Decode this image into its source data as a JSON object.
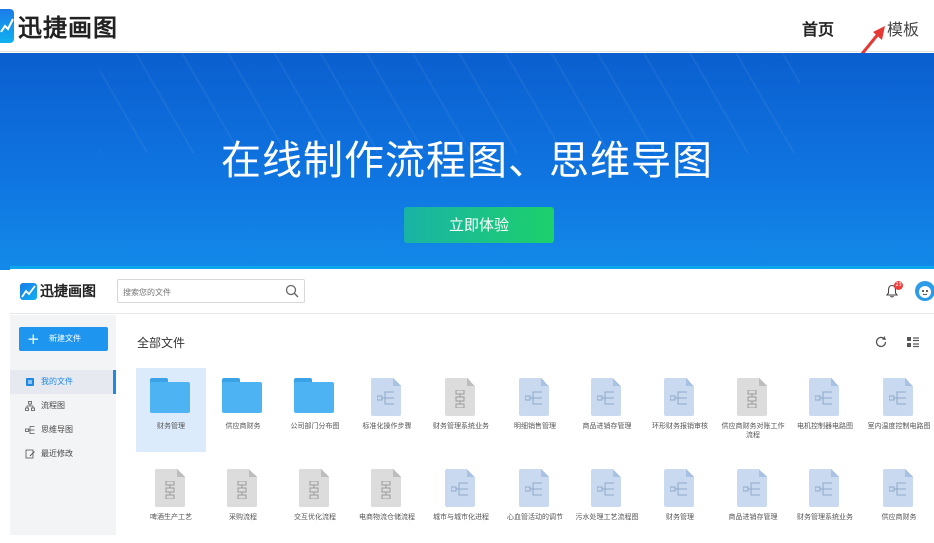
{
  "site": {
    "logo_text": "迅捷画图",
    "nav": {
      "home": "首页",
      "templates": "模板"
    }
  },
  "hero": {
    "title": "在线制作流程图、思维导图",
    "cta": "立即体验"
  },
  "app": {
    "logo_text": "迅捷画图",
    "search_placeholder": "搜索您的文件",
    "notification_count": "23",
    "sidebar": {
      "new_file": "新建文件",
      "items": [
        {
          "label": "我的文件",
          "icon": "folder-icon",
          "active": true
        },
        {
          "label": "流程图",
          "icon": "flowchart-icon"
        },
        {
          "label": "思维导图",
          "icon": "mindmap-icon"
        },
        {
          "label": "最近修改",
          "icon": "recent-icon"
        }
      ]
    },
    "main": {
      "title": "全部文件",
      "row1": [
        {
          "name": "财务管理",
          "type": "folder",
          "selected": true
        },
        {
          "name": "供应商财务",
          "type": "folder"
        },
        {
          "name": "公司部门分布图",
          "type": "folder"
        },
        {
          "name": "标准化操作步骤",
          "type": "mindmap"
        },
        {
          "name": "财务管理系统业务",
          "type": "flow"
        },
        {
          "name": "明细销售管理",
          "type": "mindmap"
        },
        {
          "name": "商品进销存管理",
          "type": "mindmap"
        },
        {
          "name": "环形财务报销审核",
          "type": "mindmap"
        },
        {
          "name": "供应商财务对账工作流程",
          "type": "flow"
        },
        {
          "name": "电机控制器电路图",
          "type": "mindmap"
        },
        {
          "name": "室内温度控制电路图",
          "type": "mindmap"
        }
      ],
      "row2": [
        {
          "name": "啤酒生产工艺",
          "type": "flow"
        },
        {
          "name": "采购流程",
          "type": "flow"
        },
        {
          "name": "交互优化流程",
          "type": "flow"
        },
        {
          "name": "电商物流仓储流程",
          "type": "flow"
        },
        {
          "name": "城市与城市化进程",
          "type": "mindmap"
        },
        {
          "name": "心血管活动的调节",
          "type": "mindmap"
        },
        {
          "name": "污水处理工艺流程图",
          "type": "mindmap"
        },
        {
          "name": "财务管理",
          "type": "mindmap"
        },
        {
          "name": "商品进销存管理",
          "type": "mindmap"
        },
        {
          "name": "财务管理系统业务",
          "type": "mindmap"
        },
        {
          "name": "供应商财务",
          "type": "mindmap"
        }
      ]
    }
  }
}
